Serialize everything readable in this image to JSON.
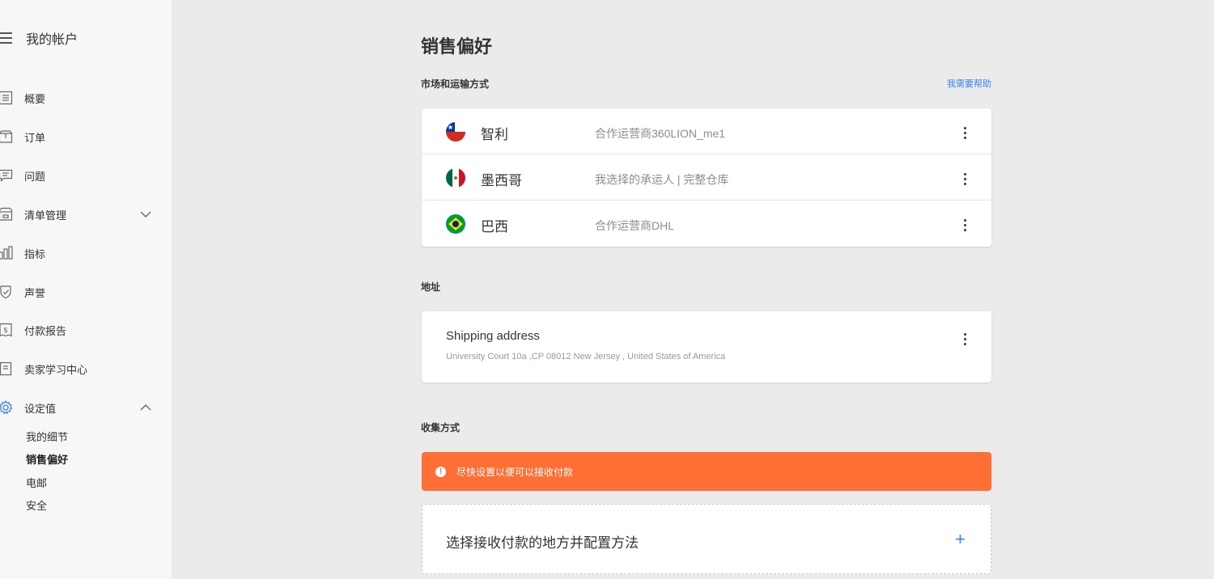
{
  "sidebar": {
    "title": "我的帐户",
    "items": [
      {
        "label": "概要",
        "icon": "summary-icon"
      },
      {
        "label": "订单",
        "icon": "orders-icon"
      },
      {
        "label": "问题",
        "icon": "questions-icon"
      },
      {
        "label": "清单管理",
        "icon": "listings-icon"
      },
      {
        "label": "指标",
        "icon": "metrics-icon"
      },
      {
        "label": "声誉",
        "icon": "reputation-icon"
      },
      {
        "label": "付款报告",
        "icon": "payment-report-icon"
      },
      {
        "label": "卖家学习中心",
        "icon": "learning-center-icon"
      },
      {
        "label": "设定值",
        "icon": "settings-icon"
      }
    ],
    "settings_sub": [
      "我的细节",
      "销售偏好",
      "电邮",
      "安全"
    ],
    "active_sub": "销售偏好"
  },
  "main": {
    "page_title": "销售偏好",
    "markets_section": "市场和运输方式",
    "help_link": "我需要帮助",
    "markets": [
      {
        "country": "智利",
        "carrier": "合作运营商360LION_me1",
        "flag": "chile-flag-icon"
      },
      {
        "country": "墨西哥",
        "carrier": "我选择的承运人 | 完整仓库",
        "flag": "mexico-flag-icon"
      },
      {
        "country": "巴西",
        "carrier": "合作运营商DHL",
        "flag": "brazil-flag-icon"
      }
    ],
    "address_section": "地址",
    "address": {
      "title": "Shipping address",
      "line": "University Court 10a ,CP 08012 New Jersey , United States of America"
    },
    "collection_section": "收集方式",
    "alert_text": "尽快设置以便可以接收付款",
    "payment_prompt": "选择接收付款的地方并配置方法"
  },
  "colors": {
    "accent": "#3483fa",
    "alert": "#ff6e35",
    "background": "#ebebeb",
    "sidebar": "#f7f7f7"
  }
}
